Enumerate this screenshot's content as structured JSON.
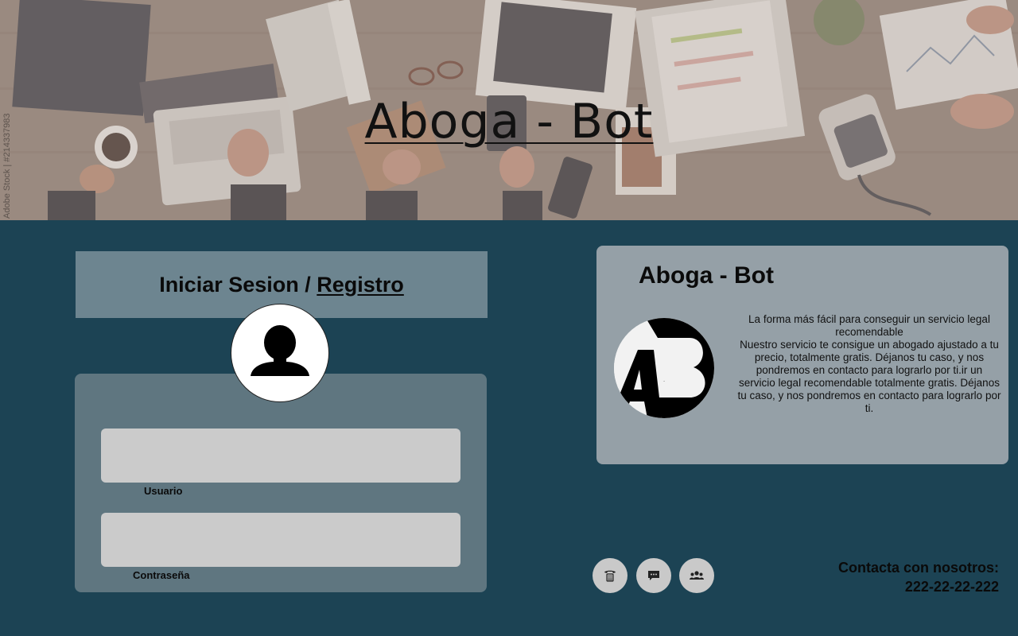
{
  "hero": {
    "title": "Aboga - Bot",
    "watermark": "Adobe Stock | #214337983"
  },
  "login": {
    "heading_login": "Iniciar Sesion",
    "heading_separator": " / ",
    "heading_register": "Registro",
    "username_label": "Usuario",
    "password_label": "Contraseña",
    "username_value": "",
    "password_value": ""
  },
  "info": {
    "title": "Aboga - Bot",
    "logo_letters": "AB",
    "lines": [
      "La forma más fácil para conseguir un servicio legal recomendable",
      "Nuestro servicio te consigue un abogado ajustado a tu precio, totalmente gratis. Déjanos tu caso, y nos pondremos en contacto para lograrlo por ti.ir un servicio legal recomendable totalmente gratis. Déjanos tu caso, y nos pondremos en contacto para lograrlo por ti."
    ]
  },
  "contact": {
    "buttons": [
      "phone-icon",
      "chat-icon",
      "group-icon"
    ],
    "label": "Contacta con nosotros:",
    "phone": "222-22-22-222"
  },
  "colors": {
    "background": "#1c4354",
    "login_header": "#6d8590",
    "login_card": "#5f7680",
    "info_card": "#95a0a7",
    "input": "#cbcbcb"
  }
}
